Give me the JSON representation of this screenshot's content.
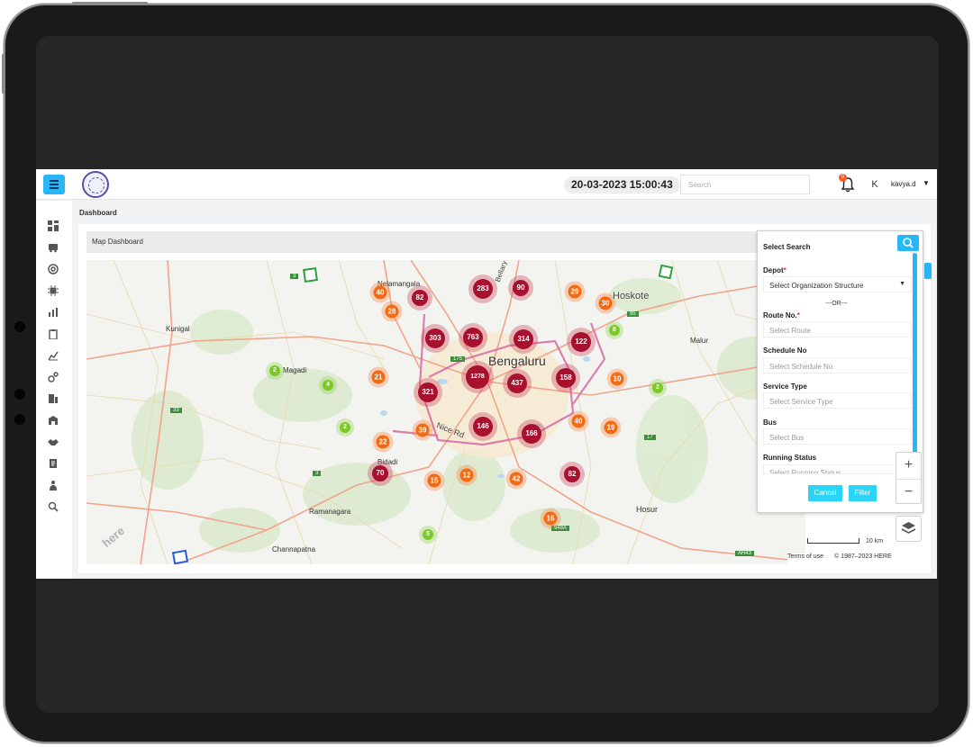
{
  "header": {
    "datetime": "20-03-2023 15:00:43",
    "search_placeholder": "Search",
    "notification_count": "0",
    "avatar_initial": "K",
    "username": "kavya.d"
  },
  "breadcrumb": "Dashboard",
  "panel_title": "Map Dashboard",
  "map": {
    "places": [
      {
        "id": "bengaluru",
        "label": "Bengaluru"
      },
      {
        "id": "hoskote",
        "label": "Hoskote"
      },
      {
        "id": "nelamangala",
        "label": "Nelamangala"
      },
      {
        "id": "kunigal",
        "label": "Kunigal"
      },
      {
        "id": "magadi",
        "label": "Magadi"
      },
      {
        "id": "bidadi",
        "label": "Bidadi"
      },
      {
        "id": "ramanagara",
        "label": "Ramanagara"
      },
      {
        "id": "channapatna",
        "label": "Channapatna"
      },
      {
        "id": "hosur",
        "label": "Hosur"
      },
      {
        "id": "malur",
        "label": "Malur"
      },
      {
        "id": "nice-rd",
        "label": "Nice Rd"
      },
      {
        "id": "bellary",
        "label": "Bellary"
      }
    ],
    "clusters": [
      {
        "count": "40",
        "level": "orange"
      },
      {
        "count": "82",
        "level": "red"
      },
      {
        "count": "28",
        "level": "orange"
      },
      {
        "count": "283",
        "level": "red"
      },
      {
        "count": "90",
        "level": "red"
      },
      {
        "count": "29",
        "level": "orange"
      },
      {
        "count": "30",
        "level": "orange"
      },
      {
        "count": "303",
        "level": "red"
      },
      {
        "count": "763",
        "level": "red"
      },
      {
        "count": "314",
        "level": "red"
      },
      {
        "count": "122",
        "level": "red"
      },
      {
        "count": "8",
        "level": "green"
      },
      {
        "count": "2",
        "level": "green"
      },
      {
        "count": "4",
        "level": "green"
      },
      {
        "count": "21",
        "level": "orange"
      },
      {
        "count": "1278",
        "level": "red"
      },
      {
        "count": "437",
        "level": "red"
      },
      {
        "count": "158",
        "level": "red"
      },
      {
        "count": "10",
        "level": "orange"
      },
      {
        "count": "2",
        "level": "green"
      },
      {
        "count": "321",
        "level": "red"
      },
      {
        "count": "2",
        "level": "green"
      },
      {
        "count": "39",
        "level": "orange"
      },
      {
        "count": "146",
        "level": "red"
      },
      {
        "count": "166",
        "level": "red"
      },
      {
        "count": "40",
        "level": "orange"
      },
      {
        "count": "19",
        "level": "orange"
      },
      {
        "count": "22",
        "level": "orange"
      },
      {
        "count": "70",
        "level": "red"
      },
      {
        "count": "15",
        "level": "orange"
      },
      {
        "count": "12",
        "level": "orange"
      },
      {
        "count": "42",
        "level": "orange"
      },
      {
        "count": "82",
        "level": "red"
      },
      {
        "count": "16",
        "level": "orange"
      },
      {
        "count": "5",
        "level": "green"
      }
    ],
    "shields": [
      {
        "label": "3"
      },
      {
        "label": "95"
      },
      {
        "label": "17"
      },
      {
        "label": "33"
      },
      {
        "label": "3"
      },
      {
        "label": "948A"
      },
      {
        "label": "AH43"
      },
      {
        "label": "175"
      }
    ],
    "watermark": "here",
    "scale_label": "10 km",
    "terms_label": "Terms of use",
    "copyright": "© 1987–2023 HERE"
  },
  "select_search": {
    "title": "Select Search",
    "depot_label": "Depot",
    "required_mark": "*",
    "depot_value": "Select Organization Structure",
    "or_text": "---OR---",
    "route_label": "Route No.",
    "route_placeholder": "Select Route",
    "schedule_label": "Schedule No",
    "schedule_placeholder": "Select Schedule No",
    "service_label": "Service Type",
    "service_placeholder": "Select Service Type",
    "bus_label": "Bus",
    "bus_placeholder": "Select Bus",
    "running_label": "Running Status",
    "running_placeholder": "Select Running Status",
    "cancel_label": "Cancel",
    "filter_label": "Filter"
  },
  "colors": {
    "accent": "#29b6f6",
    "cluster_red": "#a8102e",
    "cluster_orange": "#f36a12",
    "cluster_green": "#7cc827"
  },
  "sidebar_icons": [
    "dashboard-icon",
    "bus-icon",
    "lifebuoy-icon",
    "chip-icon",
    "bar-chart-icon",
    "clipboard-icon",
    "line-chart-icon",
    "settings-link-icon",
    "ticket-icon",
    "depot-icon",
    "handshake-icon",
    "document-icon",
    "person-icon",
    "zoom-search-icon"
  ]
}
